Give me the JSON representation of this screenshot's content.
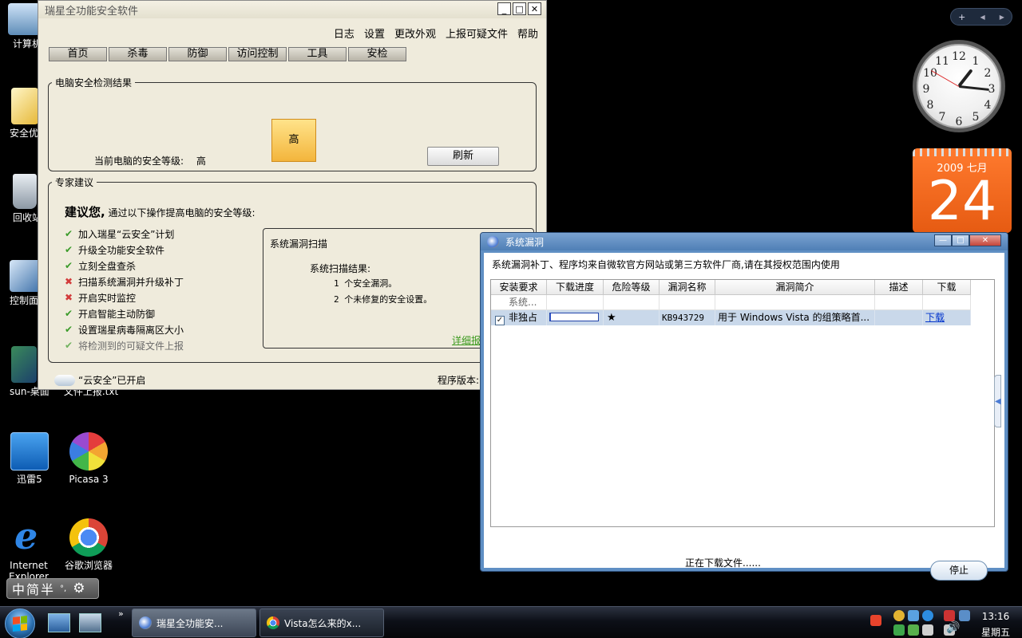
{
  "desktop": {
    "icons": [
      {
        "label": "计算机"
      },
      {
        "label": "安全优"
      },
      {
        "label": "回收站"
      },
      {
        "label": "控制面"
      },
      {
        "label": "sun-桌面"
      },
      {
        "label": "文件上报.txt"
      },
      {
        "label": "迅雷5"
      },
      {
        "label": "Picasa 3"
      },
      {
        "label": "Internet Explorer"
      },
      {
        "label": "谷歌浏览器"
      }
    ]
  },
  "gadgets": {
    "bar": {
      "add": "+",
      "prev": "◀",
      "next": "▶"
    },
    "clock": {
      "time": "13:16",
      "numbers": [
        "12",
        "1",
        "2",
        "3",
        "4",
        "5",
        "6",
        "7",
        "8",
        "9",
        "10",
        "11"
      ]
    },
    "calendar": {
      "year_month": "2009 七月",
      "day": "24"
    }
  },
  "main_window": {
    "title": "瑞星全功能安全软件",
    "controls": {
      "minimize": "_",
      "maximize": "□",
      "close": "✕"
    },
    "menu": [
      "日志",
      "设置",
      "更改外观",
      "上报可疑文件",
      "帮助"
    ],
    "tabs": [
      "首页",
      "杀毒",
      "防御",
      "访问控制",
      "工具",
      "安检"
    ],
    "result_group": {
      "legend": "电脑安全检测结果",
      "level_badge": "高",
      "level_label": "当前电脑的安全等级:",
      "level_value": "高",
      "refresh_button": "刷新"
    },
    "advice_group": {
      "legend": "专家建议",
      "heading_bold": "建议您,",
      "heading_rest": "通过以下操作提高电脑的安全等级:",
      "items": [
        {
          "text": "加入瑞星“云安全”计划",
          "status": "ok"
        },
        {
          "text": "升级全功能安全软件",
          "status": "ok"
        },
        {
          "text": "立刻全盘查杀",
          "status": "ok"
        },
        {
          "text": "扫描系统漏洞并升级补丁",
          "status": "bad"
        },
        {
          "text": "开启实时监控",
          "status": "bad"
        },
        {
          "text": "开启智能主动防御",
          "status": "ok"
        },
        {
          "text": "设置瑞星病毒隔离区大小",
          "status": "ok"
        },
        {
          "text": "将检测到的可疑文件上报",
          "status": "ok_dim"
        }
      ],
      "scan_box": {
        "title": "系统漏洞扫描",
        "result_title": "系统扫描结果:",
        "line1": "1 个安全漏洞。",
        "line2": "2 个未修复的安全设置。",
        "detail_link": "详细报"
      }
    },
    "footer": {
      "cloud_status": "“云安全”已开启",
      "version_label": "程序版本:"
    }
  },
  "dialog": {
    "title": "系统漏洞",
    "controls": {
      "minimize": "—",
      "maximize": "□",
      "close": "✕"
    },
    "note": "系统漏洞补丁、程序均来自微软官方网站或第三方软件厂商,请在其授权范围内使用",
    "columns": [
      "安装要求",
      "下载进度",
      "危险等级",
      "漏洞名称",
      "漏洞简介",
      "描述",
      "下载"
    ],
    "group_row": "系统...",
    "rows": [
      {
        "checked": true,
        "requirement": "非独占",
        "progress": 0.02,
        "danger": "★",
        "name": "KB943729",
        "summary": "用于 Windows Vista 的组策略首...",
        "desc": "",
        "download": "下载"
      }
    ],
    "status": "正在下载文件......",
    "stop_button": "停止"
  },
  "ime": {
    "chars": [
      "中",
      "简",
      "半"
    ],
    "punct": "°,"
  },
  "taskbar": {
    "tasks": [
      {
        "label": "瑞星全功能安...",
        "active": true
      },
      {
        "label": "Vista怎么来的x...",
        "active": false
      }
    ],
    "more": "»",
    "time": "13:16",
    "weekday": "星期五"
  },
  "colors": {
    "window_bg": "#efebdc",
    "level_badge": "#f6c24a",
    "ok_mark": "#3b9b2a",
    "bad_mark": "#d23a3a",
    "link": "#0033cc",
    "calendar": "#f2661e",
    "dialog_frame": "#5f8fc4"
  }
}
